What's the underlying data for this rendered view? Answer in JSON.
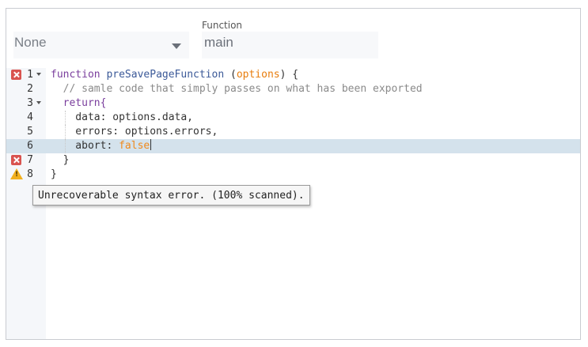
{
  "selector": {
    "value": "None"
  },
  "function_field": {
    "label": "Function",
    "value": "main"
  },
  "editor": {
    "lines": [
      {
        "num": "1",
        "tokens": {
          "a": "function ",
          "b": "preSavePageFunction",
          "c": " (",
          "d": "options",
          "e": ") {"
        }
      },
      {
        "num": "2",
        "tokens": {
          "a": "  // samle code that simply passes on what has been exported"
        }
      },
      {
        "num": "3",
        "tokens": {
          "a": "  return{"
        }
      },
      {
        "num": "4",
        "tokens": {
          "a": "    data: options.data,"
        }
      },
      {
        "num": "5",
        "tokens": {
          "a": "    errors: options.errors,"
        }
      },
      {
        "num": "6",
        "tokens": {
          "a": "    abort: ",
          "b": "false"
        }
      },
      {
        "num": "7",
        "tokens": {
          "a": "  }"
        }
      },
      {
        "num": "8",
        "tokens": {
          "a": "}"
        }
      }
    ],
    "tooltip": "Unrecoverable syntax error. (100% scanned)."
  },
  "colors": {
    "accent_error": "#d9534f",
    "accent_warning": "#f2b01e",
    "active_line": "#d4e2ec"
  }
}
